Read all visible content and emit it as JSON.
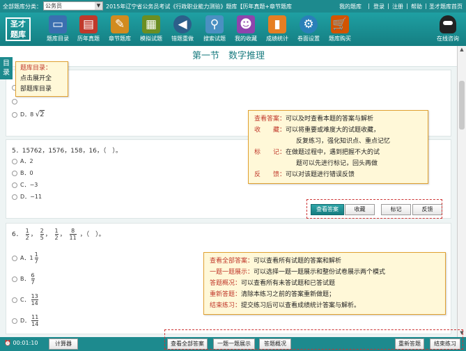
{
  "topbar": {
    "cat_label": "全部题库分类：",
    "cat_value": "公务员",
    "title": "2015年辽宁省公务员考试《行政职业能力测验》题库【历年真题+章节题库",
    "links": [
      "我的题库",
      "登录",
      "注册",
      "帮助",
      "圣才题库首页"
    ]
  },
  "logo": {
    "line1": "圣才",
    "line2": "题库"
  },
  "toolbar": [
    {
      "label": "题库目录",
      "icon": "monitor-icon",
      "color": "#3a6fb0"
    },
    {
      "label": "历年真题",
      "icon": "book-icon",
      "color": "#c0392b"
    },
    {
      "label": "章节题库",
      "icon": "pencil-icon",
      "color": "#d18b1f"
    },
    {
      "label": "模拟试题",
      "icon": "paper-icon",
      "color": "#6b8e23"
    },
    {
      "label": "错题重做",
      "icon": "arrow-icon",
      "color": "#2c5f8a"
    },
    {
      "label": "搜索试题",
      "icon": "search-icon",
      "color": "#4a90c2"
    },
    {
      "label": "我的收藏",
      "icon": "user-icon",
      "color": "#8e44ad"
    },
    {
      "label": "成绩统计",
      "icon": "chart-icon",
      "color": "#e67e22"
    },
    {
      "label": "卷面设置",
      "icon": "gear-icon",
      "color": "#2980b9"
    },
    {
      "label": "题库购买",
      "icon": "cart-icon",
      "color": "#d35400"
    }
  ],
  "qq_label": "在线咨询",
  "section_title": "第一节　数字推理",
  "sidetab": "目录",
  "q4_option_d": "D．8",
  "q4_radical": "2",
  "q5": {
    "stem": "5．15762，1576，158，16，（　）。",
    "options": [
      "A．2",
      "B．0",
      "C．−3",
      "D．−11"
    ]
  },
  "q6": {
    "prefix": "6．",
    "fracs": [
      [
        "1",
        "2"
      ],
      [
        "2",
        "5"
      ],
      [
        "1",
        "2"
      ],
      [
        "8",
        "11"
      ]
    ],
    "tail": "，（　）。",
    "optA": "A．1",
    "optA_frac": [
      "1",
      "7"
    ],
    "optB": "B．",
    "optB_frac": [
      "6",
      "7"
    ],
    "optC": "C．",
    "optC_frac": [
      "13",
      "14"
    ],
    "optD": "D．",
    "optD_frac": [
      "11",
      "14"
    ]
  },
  "question_buttons": [
    "查看答案",
    "收藏",
    "标记",
    "反馈"
  ],
  "tip_catalog": [
    "题库目录：",
    "点击展开全",
    "部题库目录"
  ],
  "tip_q": [
    {
      "k": "查看答案：",
      "v": "可以及时查看本题的答案与解析"
    },
    {
      "k": "收　　藏：",
      "v": "可以将重要或难度大的试题收藏，"
    },
    {
      "k": "",
      "v": "反复练习，强化知识点、重点记忆"
    },
    {
      "k": "标　　记：",
      "v": "在做题过程中，遇到把握不大的试"
    },
    {
      "k": "",
      "v": "题可以先进行标记，回头再做"
    },
    {
      "k": "反　　馈：",
      "v": "可以对该题进行错误反馈"
    }
  ],
  "tip_bottom": [
    {
      "k": "查看全部答案：",
      "v": "可以查看所有试题的答案和解析"
    },
    {
      "k": "一题一题展示：",
      "v": "可以选择一题一题展示和整份试卷展示两个模式"
    },
    {
      "k": "答题概况：",
      "v": "可以查看所有未答试题和已答试题"
    },
    {
      "k": "重新答题：",
      "v": "清除本练习之前的答案重新做题；"
    },
    {
      "k": "结束练习：",
      "v": "提交练习后可以查看成绩统计答案与解析。"
    }
  ],
  "bottom": {
    "timer": "00:01:10",
    "calc": "计算器",
    "buttons": [
      "查看全部答案",
      "一题一题展示",
      "答题概况"
    ],
    "right_buttons": [
      "重新答题",
      "结束练习"
    ]
  }
}
